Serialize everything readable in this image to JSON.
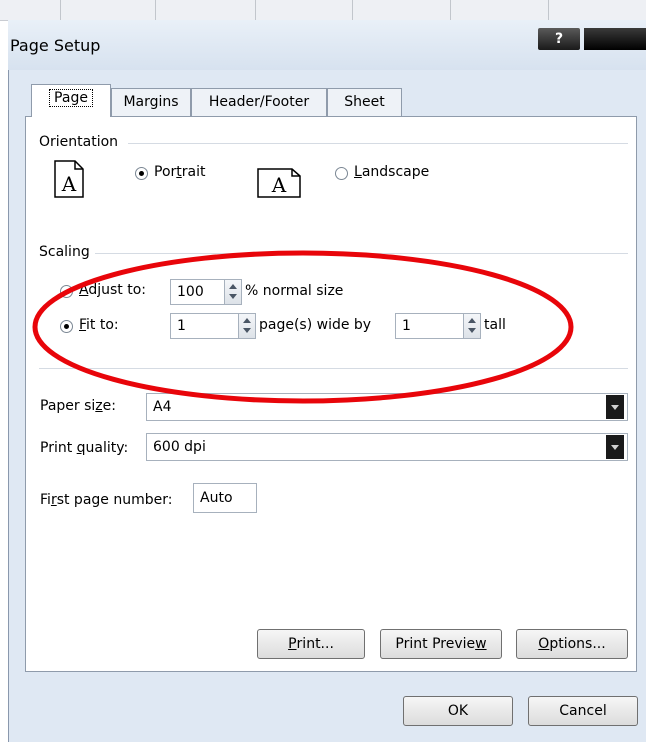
{
  "dialog": {
    "title": "Page Setup",
    "help_label": "?"
  },
  "tabs": [
    {
      "label": "Page",
      "active": true
    },
    {
      "label": "Margins"
    },
    {
      "label": "Header/Footer"
    },
    {
      "label": "Sheet"
    }
  ],
  "orientation": {
    "heading": "Orientation",
    "portrait_icon_glyph": "A",
    "portrait_pre": "Por",
    "portrait_key": "t",
    "portrait_post": "rait",
    "landscape_icon_glyph": "A",
    "landscape_key": "L",
    "landscape_post": "andscape",
    "selected": "portrait"
  },
  "scaling": {
    "heading": "Scaling",
    "adjust_key": "A",
    "adjust_post": "djust to:",
    "adjust_value": "100",
    "adjust_suffix": "% normal size",
    "fit_key": "F",
    "fit_post": "it to:",
    "fit_wide_value": "1",
    "fit_wide_suffix": "page(s) wide by",
    "fit_tall_value": "1",
    "fit_tall_suffix": "tall",
    "selected": "fit"
  },
  "paper": {
    "size_pre": "Paper si",
    "size_key": "z",
    "size_post": "e:",
    "size_value": "A4",
    "quality_pre": "Print ",
    "quality_key": "q",
    "quality_post": "uality:",
    "quality_value": "600 dpi",
    "first_pre": "Fi",
    "first_key": "r",
    "first_post": "st page number:",
    "first_value": "Auto"
  },
  "buttons": {
    "print_key": "P",
    "print_post": "rint...",
    "preview_pre": "Print Previe",
    "preview_key": "w",
    "options_key": "O",
    "options_post": "ptions...",
    "ok": "OK",
    "cancel": "Cancel"
  },
  "colors": {
    "highlight": "#e8050a",
    "dialog_bg": "#dfe8f3"
  }
}
